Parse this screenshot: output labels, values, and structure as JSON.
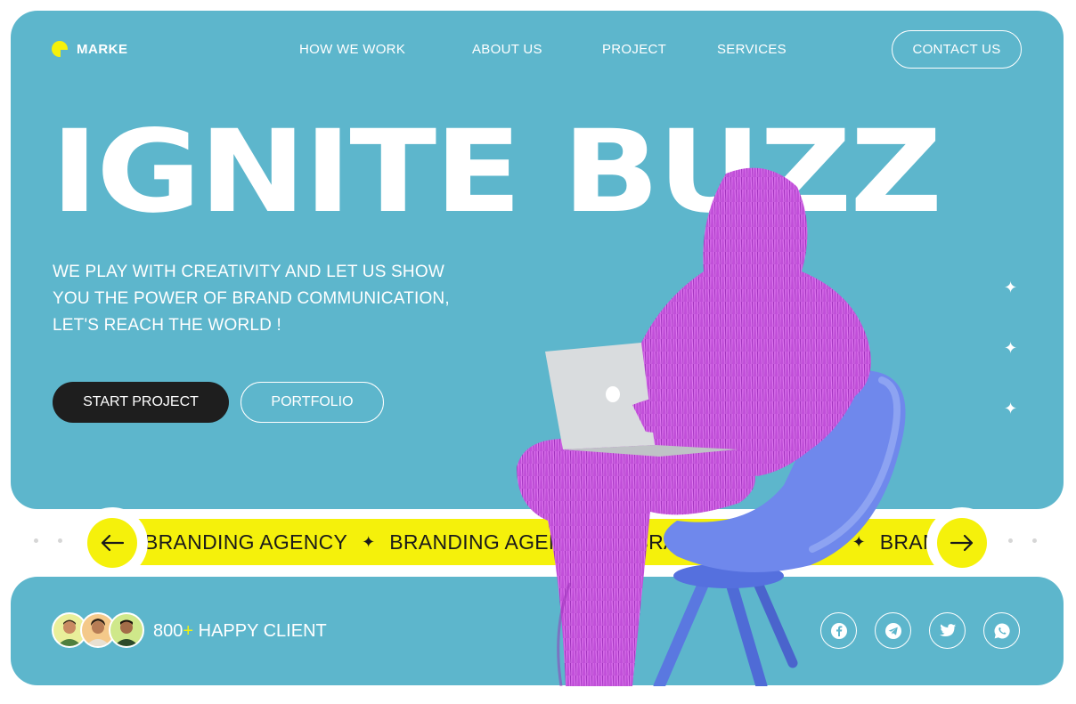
{
  "brand": {
    "name": "MARKE",
    "accent": "#f5f10b",
    "background": "#5db6cc"
  },
  "nav": {
    "items": [
      "HOW WE WORK",
      "ABOUT US",
      "PROJECT",
      "SERVICES"
    ],
    "contact_label": "CONTACT US"
  },
  "hero": {
    "headline": "IGNITE BUZZ",
    "tagline_lines": [
      "WE PLAY WITH CREATIVITY AND LET US SHOW",
      "YOU THE POWER OF BRAND COMMUNICATION,",
      "LET'S REACH THE WORLD !"
    ],
    "primary_button": "START PROJECT",
    "secondary_button": "PORTFOLIO"
  },
  "ticker": {
    "items": [
      "BRANDING AGENCY",
      "BRANDING AGENCY",
      "BRANDING AGENCY",
      "BRANDING AGENCY"
    ],
    "separator_icon": "four-point-star-icon"
  },
  "carousel": {
    "prev_icon": "arrow-left-icon",
    "next_icon": "arrow-right-icon"
  },
  "clients": {
    "count": "800",
    "plus": "+",
    "label": " HAPPY CLIENT"
  },
  "social": [
    "facebook-icon",
    "telegram-icon",
    "twitter-icon",
    "whatsapp-icon"
  ]
}
